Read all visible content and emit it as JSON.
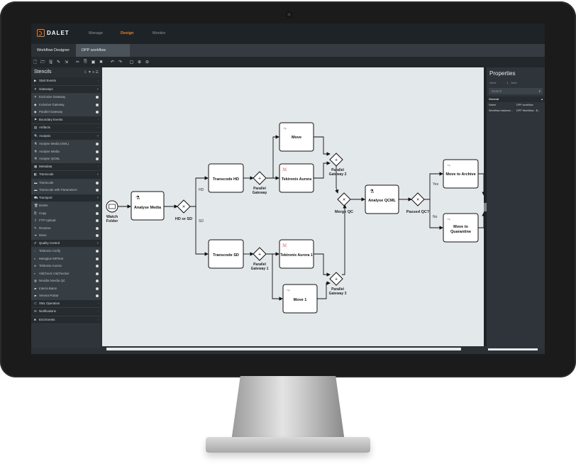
{
  "app": {
    "brand": "DALET",
    "nav": [
      "Manage",
      "Design",
      "Monitor"
    ],
    "nav_active": "Design",
    "accent_color": "#f07c22"
  },
  "tabs": [
    "Workflow Designer",
    "DPP workflow"
  ],
  "toolbar_icons": [
    "new-icon",
    "open-icon",
    "save-icon",
    "save-as-icon",
    "export-icon",
    "cut-icon",
    "copy-icon",
    "paste-icon",
    "delete-icon",
    "undo-icon",
    "redo-icon",
    "fit-icon",
    "zoom-in-icon",
    "zoom-out-icon"
  ],
  "stencils": {
    "title": "Stencils",
    "rows": [
      {
        "type": "cat",
        "label": "Start Events",
        "icon": "▶",
        "arrow": "›"
      },
      {
        "type": "cat",
        "label": "Gateways",
        "icon": "✕",
        "arrow": "▾"
      },
      {
        "type": "item",
        "label": "Exclusive Gateway",
        "icon": "✕"
      },
      {
        "type": "item",
        "label": "Inclusive Gateway",
        "icon": "◆"
      },
      {
        "type": "item",
        "label": "Parallel Gateway",
        "icon": "◆"
      },
      {
        "type": "cat",
        "label": "Boundary Events",
        "icon": "⚑",
        "arrow": "›"
      },
      {
        "type": "cat",
        "label": "Artifacts",
        "icon": "▤",
        "arrow": "›"
      },
      {
        "type": "cat",
        "label": "Analysis",
        "icon": "🔍",
        "arrow": "▾"
      },
      {
        "type": "item",
        "label": "Analyse Media (XML)",
        "icon": "⚗"
      },
      {
        "type": "item",
        "label": "Analyse Media",
        "icon": "⚗"
      },
      {
        "type": "item",
        "label": "Analyse QCML",
        "icon": "⚗"
      },
      {
        "type": "cat",
        "label": "Metadata",
        "icon": "▦",
        "arrow": "›"
      },
      {
        "type": "cat",
        "label": "Transcode",
        "icon": "◧",
        "arrow": "▾"
      },
      {
        "type": "item",
        "label": "Transcode",
        "icon": "▬"
      },
      {
        "type": "item",
        "label": "Transcode with Parameters",
        "icon": "▬"
      },
      {
        "type": "cat",
        "label": "Transport",
        "icon": "⛟",
        "arrow": "▾"
      },
      {
        "type": "item",
        "label": "Delete",
        "icon": "🗑"
      },
      {
        "type": "item",
        "label": "Copy",
        "icon": "⎘"
      },
      {
        "type": "item",
        "label": "FTP Upload",
        "icon": "⇪"
      },
      {
        "type": "item",
        "label": "Rename",
        "icon": "✎"
      },
      {
        "type": "item",
        "label": "Move",
        "icon": "➜"
      },
      {
        "type": "cat",
        "label": "Quality Control",
        "icon": "✔",
        "arrow": "▾"
      },
      {
        "type": "item",
        "label": "Tektronix Cerify",
        "icon": "◌"
      },
      {
        "type": "item",
        "label": "Metaglue MRTest",
        "icon": "◐"
      },
      {
        "type": "item",
        "label": "Tektronix Aurora",
        "icon": "⟡"
      },
      {
        "type": "item",
        "label": "VidCheck VidChecker",
        "icon": "▪"
      },
      {
        "type": "item",
        "label": "Nvvidia Nvedia QC",
        "icon": "◍"
      },
      {
        "type": "item",
        "label": "Interra Baton",
        "icon": "▰"
      },
      {
        "type": "item",
        "label": "Venera Pulsar",
        "icon": "▰"
      },
      {
        "type": "cat",
        "label": "XML Operation",
        "icon": "⊂",
        "arrow": "›"
      },
      {
        "type": "cat",
        "label": "Notifications",
        "icon": "✉",
        "arrow": "›"
      },
      {
        "type": "cat",
        "label": "End Events",
        "icon": "■",
        "arrow": "›"
      }
    ]
  },
  "diagram": {
    "tasks": {
      "analyse_media": "Analyse Media",
      "transcode_hd": "Transcode HD",
      "transcode_sd": "Transcode SD",
      "move": "Move",
      "tektronix_aurora": "Tektronix Aurora",
      "tektronix_aurora_1": "Tektronix Aurora 1",
      "move_1": "Move 1",
      "analyse_qcml": "Analyse QCML",
      "move_to_archive": "Move to Archive",
      "move_to_quarantine_1": "Move to",
      "move_to_quarantine_2": "Quarantine"
    },
    "events": {
      "watch_folder_1": "Watch",
      "watch_folder_2": "Folder"
    },
    "gateways": {
      "hd_or_sd": "HD or SD",
      "parallel_gateway_1": "Parallel",
      "parallel_gateway_1b": "Gateway",
      "parallel_gateway_sd_1": "Parallel",
      "parallel_gateway_sd_1b": "Gateway 1",
      "parallel_gateway_2": "Parallel",
      "parallel_gateway_2b": "Gateway 2",
      "parallel_gateway_3": "Parallel",
      "parallel_gateway_3b": "Gateway 3",
      "merge_qc": "Merge QC",
      "passed_qc": "Passed QC?"
    },
    "flow_labels": {
      "hd": "HD",
      "sd": "SD",
      "yes": "Yes",
      "no": "No"
    }
  },
  "properties": {
    "title": "Properties",
    "col_name": "Name",
    "col_value": "Value",
    "search_placeholder": "Search",
    "group": "General",
    "rows": [
      {
        "name": "Name",
        "value": "DPP workflow"
      },
      {
        "name": "Workflow instance...",
        "value": "DPP Workflow - $..."
      }
    ]
  }
}
